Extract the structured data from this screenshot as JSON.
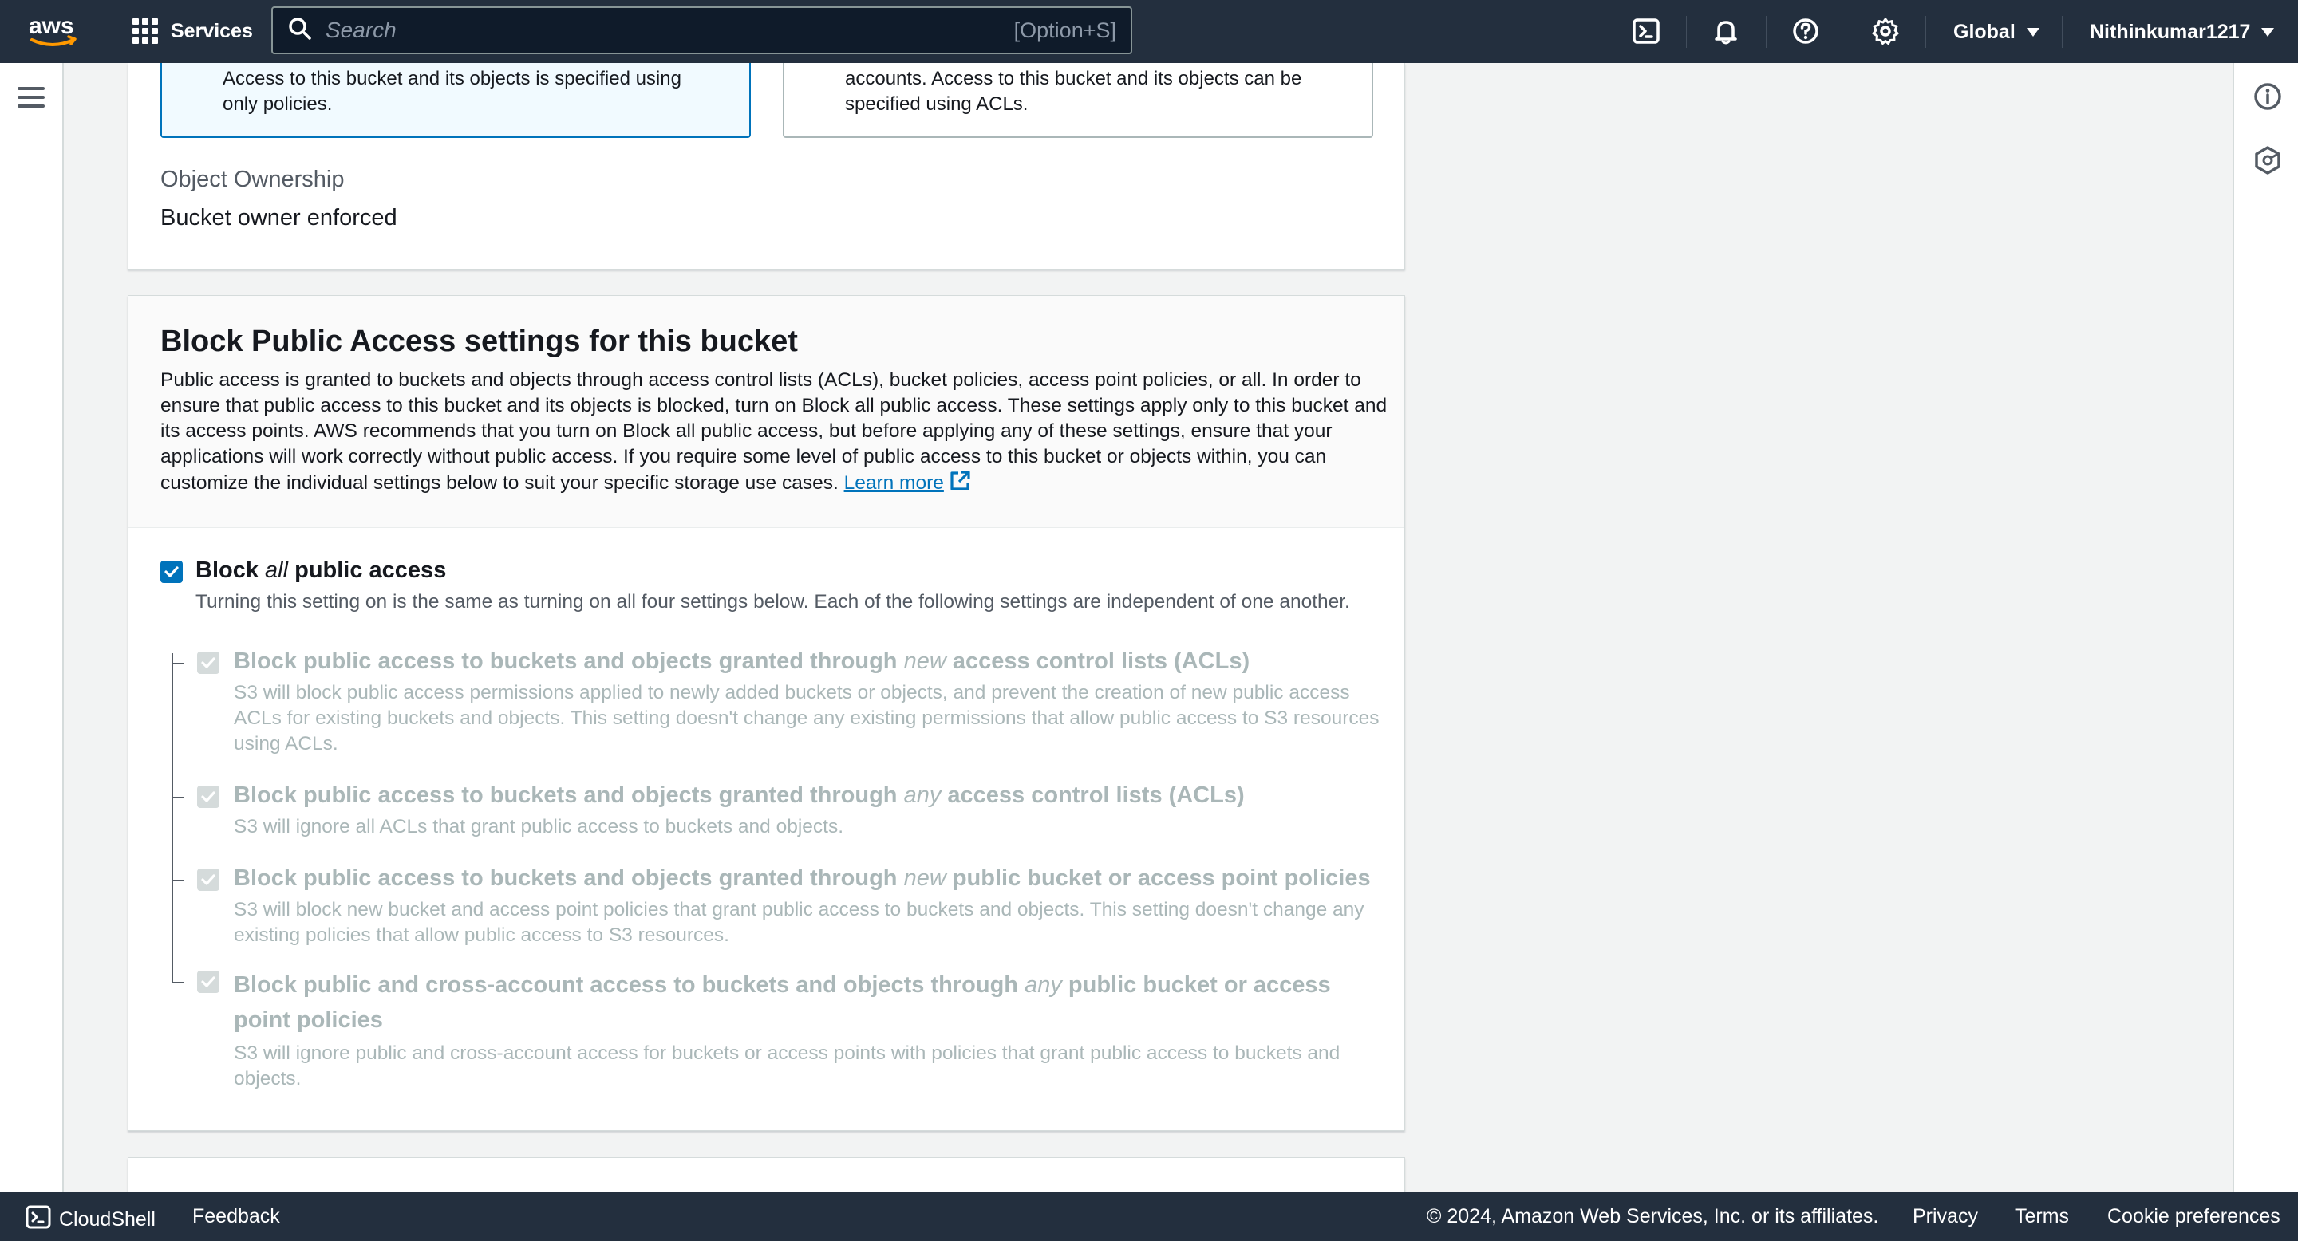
{
  "header": {
    "logo_text": "aws",
    "services_label": "Services",
    "search_placeholder": "Search",
    "search_shortcut": "[Option+S]",
    "region_label": "Global",
    "user_label": "Nithinkumar1217"
  },
  "ownership": {
    "card_left_text": "Access to this bucket and its objects is specified using only policies.",
    "card_right_text": "accounts. Access to this bucket and its objects can be specified using ACLs.",
    "label": "Object Ownership",
    "value": "Bucket owner enforced"
  },
  "block_public_access": {
    "title": "Block Public Access settings for this bucket",
    "description": "Public access is granted to buckets and objects through access control lists (ACLs), bucket policies, access point policies, or all. In order to ensure that public access to this bucket and its objects is blocked, turn on Block all public access. These settings apply only to this bucket and its access points. AWS recommends that you turn on Block all public access, but before applying any of these settings, ensure that your applications will work correctly without public access. If you require some level of public access to this bucket or objects within, you can customize the individual settings below to suit your specific storage use cases.",
    "learn_more": "Learn more",
    "block_all": {
      "label_prefix": "Block ",
      "label_em": "all",
      "label_suffix": " public access",
      "checked": true,
      "description": "Turning this setting on is the same as turning on all four settings below. Each of the following settings are independent of one another."
    },
    "options": [
      {
        "title_prefix": "Block public access to buckets and objects granted through ",
        "title_em": "new",
        "title_suffix": " access control lists (ACLs)",
        "description": "S3 will block public access permissions applied to newly added buckets or objects, and prevent the creation of new public access ACLs for existing buckets and objects. This setting doesn't change any existing permissions that allow public access to S3 resources using ACLs.",
        "checked": true
      },
      {
        "title_prefix": "Block public access to buckets and objects granted through ",
        "title_em": "any",
        "title_suffix": " access control lists (ACLs)",
        "description": "S3 will ignore all ACLs that grant public access to buckets and objects.",
        "checked": true
      },
      {
        "title_prefix": "Block public access to buckets and objects granted through ",
        "title_em": "new",
        "title_suffix": " public bucket or access point policies",
        "description": "S3 will block new bucket and access point policies that grant public access to buckets and objects. This setting doesn't change any existing policies that allow public access to S3 resources.",
        "checked": true
      },
      {
        "title_prefix": "Block public and cross-account access to buckets and objects through ",
        "title_em": "any",
        "title_suffix": " public bucket or access point policies",
        "description": "S3 will ignore public and cross-account access for buckets or access points with policies that grant public access to buckets and objects.",
        "checked": true
      }
    ]
  },
  "footer": {
    "cloudshell": "CloudShell",
    "feedback": "Feedback",
    "copyright": "© 2024, Amazon Web Services, Inc. or its affiliates.",
    "privacy": "Privacy",
    "terms": "Terms",
    "cookie": "Cookie preferences"
  },
  "colors": {
    "nav_bg": "#232f3e",
    "accent": "#0073bb",
    "disabled_text": "#aab7b8",
    "aws_orange": "#ff9900"
  },
  "icons": [
    "apps-grid-icon",
    "search-icon",
    "cloudshell-icon",
    "bell-icon",
    "help-icon",
    "gear-icon",
    "menu-icon",
    "info-icon",
    "hexagon-icon",
    "external-link-icon",
    "check-icon"
  ]
}
